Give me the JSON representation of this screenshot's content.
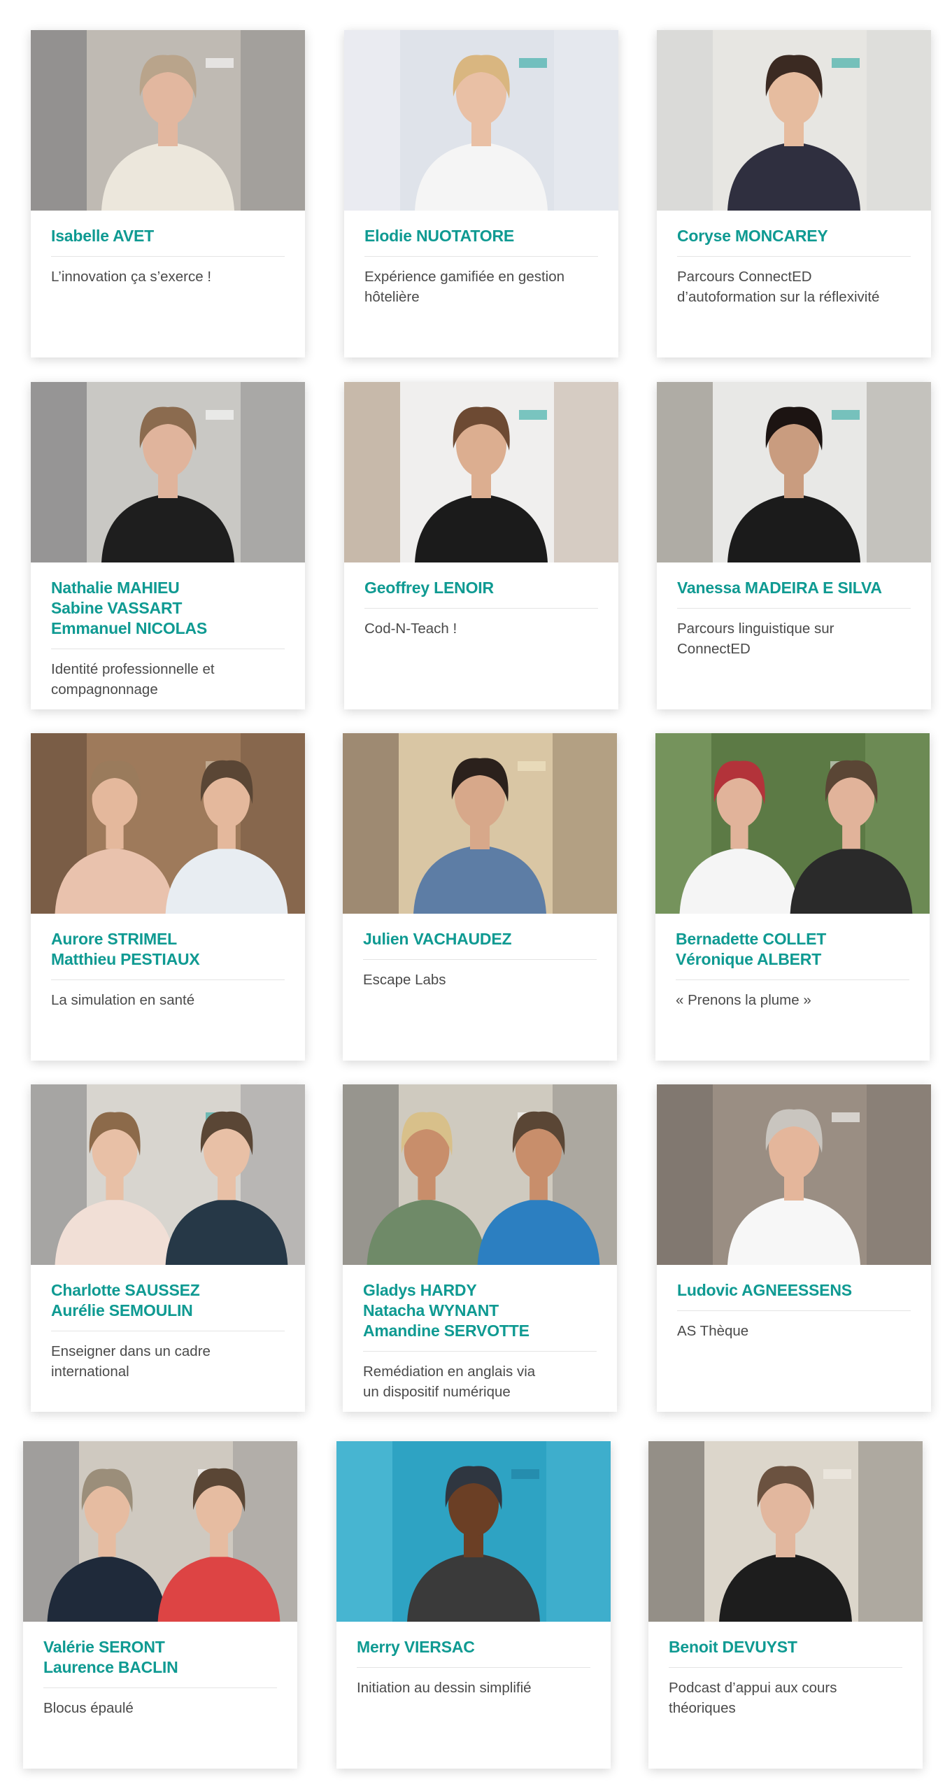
{
  "accent_color": "#0f9a92",
  "cards": [
    {
      "names": [
        "Isabelle AVET"
      ],
      "description": "L’innovation ça s’exerce !",
      "photo": "portrait-woman-speaking-floral-jacket"
    },
    {
      "names": [
        "Elodie NUOTATORE"
      ],
      "description": "Expérience gamifiée en gestion\nhôtelière",
      "photo": "portrait-woman-white-top-projection"
    },
    {
      "names": [
        "Coryse MONCAREY"
      ],
      "description": "Parcours ConnectED\nd’autoformation sur la réflexivité",
      "photo": "portrait-woman-floral-dress"
    },
    {
      "names": [
        "Nathalie MAHIEU",
        "Sabine VASSART",
        "Emmanuel NICOLAS"
      ],
      "description": "Identité professionnelle et\ncompagnonnage",
      "photo": "portrait-woman-hopeful-tshirt"
    },
    {
      "names": [
        "Geoffrey LENOIR"
      ],
      "description": "Cod-N-Teach !",
      "photo": "portrait-man-black-shirt"
    },
    {
      "names": [
        "Vanessa MADEIRA E SILVA"
      ],
      "description": "Parcours linguistique sur ConnectED",
      "photo": "portrait-woman-curly-hair"
    },
    {
      "names": [
        "Aurore STRIMEL",
        "Matthieu PESTIAUX"
      ],
      "description": "La simulation en santé",
      "photo": "portrait-duo-seated"
    },
    {
      "names": [
        "Julien VACHAUDEZ"
      ],
      "description": "Escape Labs",
      "photo": "portrait-man-blue-polo"
    },
    {
      "names": [
        "Bernadette COLLET",
        "Véronique ALBERT"
      ],
      "description": "« Prenons la plume »",
      "photo": "portrait-duo-waving"
    },
    {
      "names": [
        "Charlotte SAUSSEZ",
        "Aurélie SEMOULIN"
      ],
      "description": "Enseigner dans un cadre\ninternational",
      "photo": "portrait-duo-women"
    },
    {
      "names": [
        "Gladys HARDY",
        "Natacha WYNANT",
        "Amandine SERVOTTE"
      ],
      "description": "Remédiation en anglais via\nun dispositif numérique",
      "photo": "portrait-duo-green-blue"
    },
    {
      "names": [
        "Ludovic AGNEESSENS"
      ],
      "description": "AS Thèque",
      "photo": "portrait-man-grey-beard"
    },
    {
      "names": [
        "Valérie SERONT",
        "Laurence BACLIN"
      ],
      "description": "Blocus épaulé",
      "photo": "portrait-woman-glasses-lanyard"
    },
    {
      "names": [
        "Merry VIERSAC"
      ],
      "description": "Initiation au dessin simplifié",
      "photo": "portrait-man-cap-smiling"
    },
    {
      "names": [
        "Benoit DEVUYST"
      ],
      "description": "Podcast d’appui aux cours\nthéoriques",
      "photo": "portrait-man-headphones-podcast"
    }
  ]
}
